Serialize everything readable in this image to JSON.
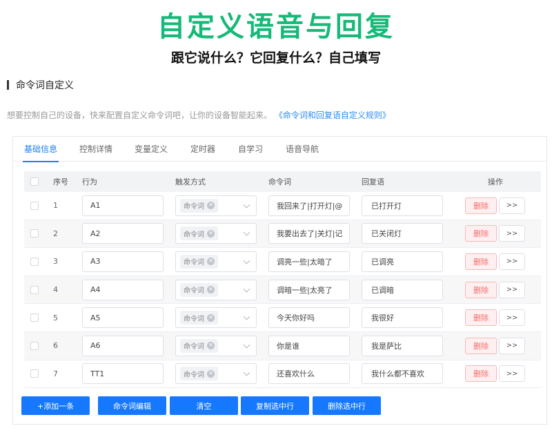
{
  "promo": {
    "title": "自定义语音与回复",
    "subtitle": "跟它说什么？它回复什么？自己填写"
  },
  "section": {
    "title": "命令词自定义",
    "hint": "想要控制自己的设备，快来配置自定义命令词吧，让你的设备智能起来。",
    "hint_link": "《命令词和回复语自定义规则》"
  },
  "tabs": [
    {
      "label": "基础信息",
      "active": true
    },
    {
      "label": "控制详情"
    },
    {
      "label": "变量定义"
    },
    {
      "label": "定时器"
    },
    {
      "label": "自学习"
    },
    {
      "label": "语音导航"
    }
  ],
  "table": {
    "headers": {
      "index": "序号",
      "action": "行为",
      "trigger": "触发方式",
      "command": "命令词",
      "reply": "回复语",
      "ops": "操作"
    },
    "rows": [
      {
        "index": "1",
        "action": "A1",
        "trigger": "命令词",
        "command": "我回来了|打开灯|@",
        "reply": "已打开灯"
      },
      {
        "index": "2",
        "action": "A2",
        "trigger": "命令词",
        "command": "我要出去了|关灯|记",
        "reply": "已关闭灯"
      },
      {
        "index": "3",
        "action": "A3",
        "trigger": "命令词",
        "command": "调亮一些|太暗了",
        "reply": "已调亮"
      },
      {
        "index": "4",
        "action": "A4",
        "trigger": "命令词",
        "command": "调暗一些|太亮了",
        "reply": "已调暗"
      },
      {
        "index": "5",
        "action": "A5",
        "trigger": "命令词",
        "command": "今天你好吗",
        "reply": "我很好"
      },
      {
        "index": "6",
        "action": "A6",
        "trigger": "命令词",
        "command": "你是谁",
        "reply": "我是萨比"
      },
      {
        "index": "7",
        "action": "TT1",
        "trigger": "命令词",
        "command": "还喜欢什么",
        "reply": "我什么都不喜欢"
      }
    ],
    "delete_label": "删除",
    "more_label": ">>",
    "tag_close": "×"
  },
  "actions": {
    "add": "+添加一条",
    "edit_commands": "命令词编辑",
    "clear": "清空",
    "copy_selected": "复制选中行",
    "delete_selected": "删除选中行"
  },
  "colors": {
    "title_green": "#17b978",
    "primary_blue": "#1677ff",
    "danger": "#f56c6c"
  }
}
